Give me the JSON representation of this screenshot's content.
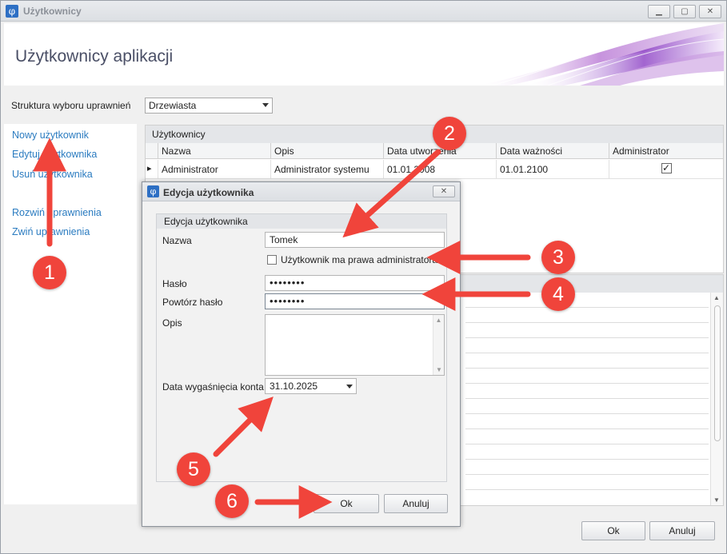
{
  "window": {
    "title": "Użytkownicy",
    "app_icon": "φ"
  },
  "header": {
    "title": "Użytkownicy aplikacji"
  },
  "structure": {
    "label": "Struktura wyboru uprawnień",
    "value": "Drzewiasta"
  },
  "left_links": [
    "Nowy użytkownik",
    "Edytuj użytkownika",
    "Usuń użytkownika",
    "Rozwiń uprawnienia",
    "Zwiń uprawnienia"
  ],
  "users": {
    "caption": "Użytkownicy",
    "columns": [
      "Nazwa",
      "Opis",
      "Data utworzenia",
      "Data ważności",
      "Administrator"
    ],
    "rows": [
      {
        "name": "Administrator",
        "description": "Administrator systemu",
        "created": "01.01.2008",
        "expires": "01.01.2100",
        "admin": true
      }
    ],
    "row_marker": "▸"
  },
  "main_buttons": {
    "ok": "Ok",
    "cancel": "Anuluj"
  },
  "dialog": {
    "title": "Edycja użytkownika",
    "icon": "φ",
    "group_caption": "Edycja użytkownika",
    "name_label": "Nazwa",
    "name_value": "Tomek",
    "admin_checkbox_label": "Użytkownik ma prawa administratora",
    "admin_checked": false,
    "password_label": "Hasło",
    "password_value": "••••••••",
    "password_repeat_label": "Powtórz hasło",
    "password_repeat_value": "••••••••",
    "description_label": "Opis",
    "description_value": "",
    "expiry_label": "Data wygaśnięcia konta",
    "expiry_value": "31.10.2025",
    "ok": "Ok",
    "cancel": "Anuluj"
  },
  "annotations": [
    "1",
    "2",
    "3",
    "4",
    "5",
    "6"
  ],
  "colors": {
    "link": "#2a7bc0",
    "annotation": "#f0443b",
    "accent": "#2d6fc4"
  }
}
